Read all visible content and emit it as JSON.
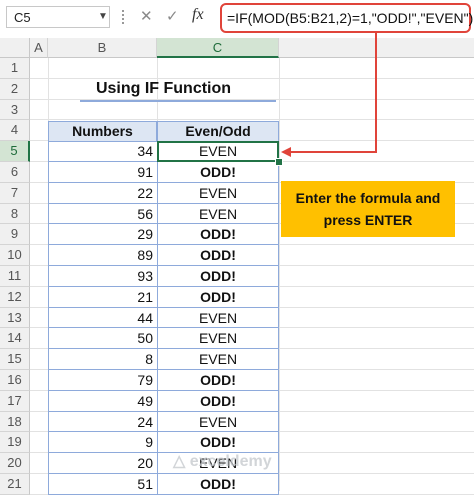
{
  "formula_bar": {
    "name_box": "C5",
    "cancel_icon": "✕",
    "enter_icon": "✓",
    "fx_label": "fx",
    "formula": "=IF(MOD(B5:B21,2)=1,\"ODD!\",\"EVEN\")"
  },
  "columns": [
    "A",
    "B",
    "C"
  ],
  "rows": [
    "1",
    "2",
    "3",
    "4",
    "5",
    "6",
    "7",
    "8",
    "9",
    "10",
    "11",
    "12",
    "13",
    "14",
    "15",
    "16",
    "17",
    "18",
    "19",
    "20",
    "21"
  ],
  "sheet": {
    "title": "Using IF Function",
    "headers": [
      "Numbers",
      "Even/Odd"
    ],
    "data": [
      {
        "n": "34",
        "r": "EVEN"
      },
      {
        "n": "91",
        "r": "ODD!"
      },
      {
        "n": "22",
        "r": "EVEN"
      },
      {
        "n": "56",
        "r": "EVEN"
      },
      {
        "n": "29",
        "r": "ODD!"
      },
      {
        "n": "89",
        "r": "ODD!"
      },
      {
        "n": "93",
        "r": "ODD!"
      },
      {
        "n": "21",
        "r": "ODD!"
      },
      {
        "n": "44",
        "r": "EVEN"
      },
      {
        "n": "50",
        "r": "EVEN"
      },
      {
        "n": "8",
        "r": "EVEN"
      },
      {
        "n": "79",
        "r": "ODD!"
      },
      {
        "n": "49",
        "r": "ODD!"
      },
      {
        "n": "24",
        "r": "EVEN"
      },
      {
        "n": "9",
        "r": "ODD!"
      },
      {
        "n": "20",
        "r": "EVEN"
      },
      {
        "n": "51",
        "r": "ODD!"
      }
    ]
  },
  "callout": {
    "text": "Enter the formula and press ENTER"
  },
  "colors": {
    "arrow": "#e0443a",
    "callout": "#ffc000",
    "selection": "#217346",
    "header_fill": "#dde6f3"
  },
  "watermark": "exceldemy"
}
